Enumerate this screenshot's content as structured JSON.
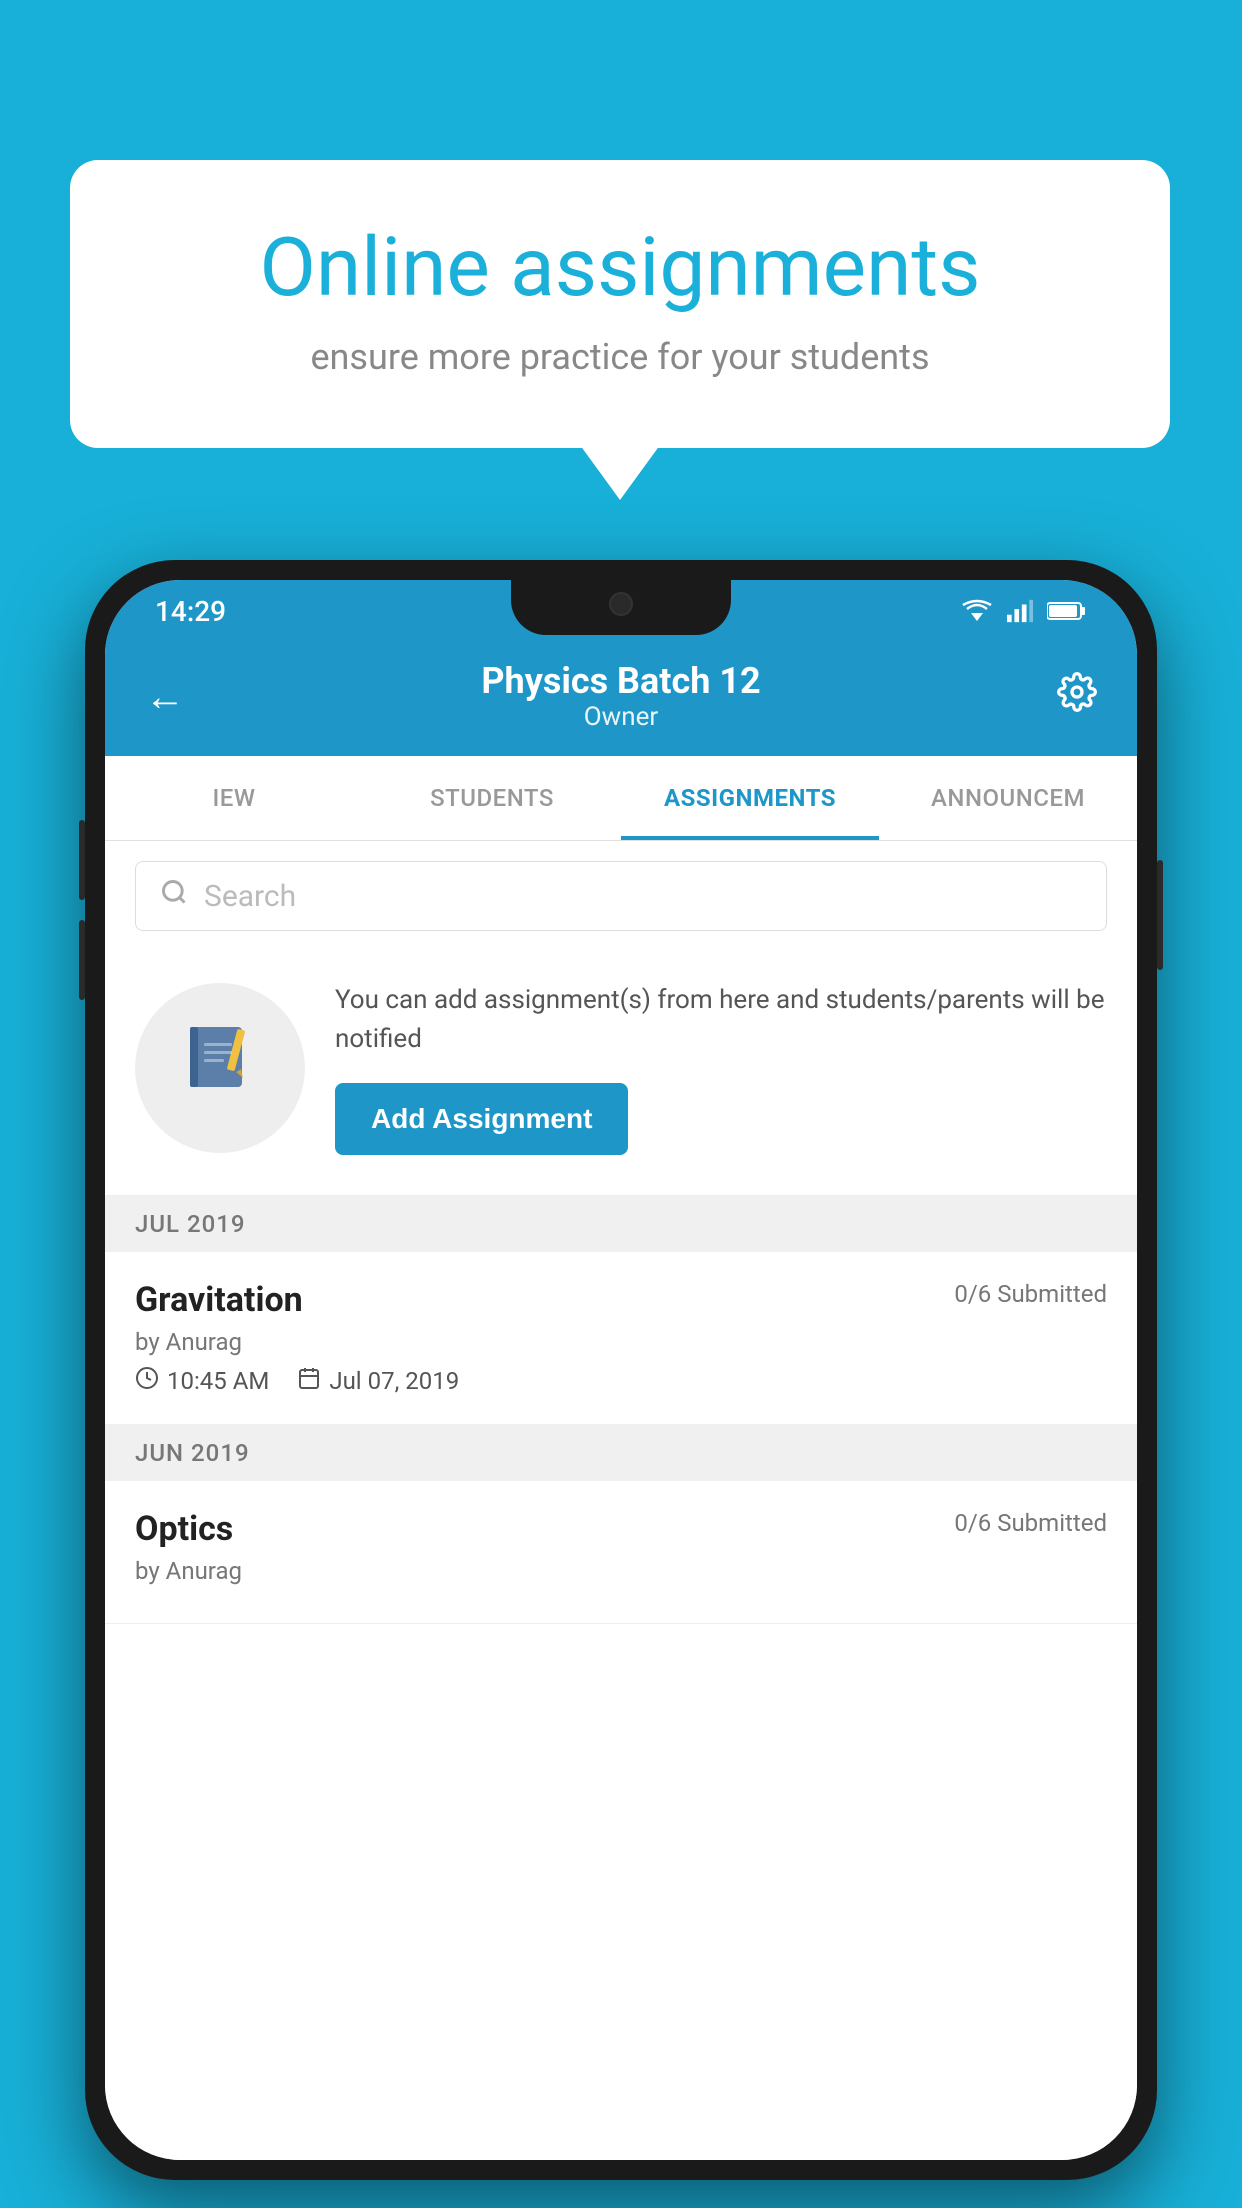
{
  "background": {
    "color": "#18b0d8"
  },
  "speech_bubble": {
    "title": "Online assignments",
    "subtitle": "ensure more practice for your students"
  },
  "phone": {
    "status_bar": {
      "time": "14:29",
      "icons": [
        "wifi",
        "signal",
        "battery"
      ]
    },
    "header": {
      "title": "Physics Batch 12",
      "subtitle": "Owner",
      "back_label": "←",
      "gear_label": "⚙"
    },
    "tabs": [
      {
        "label": "IEW",
        "active": false
      },
      {
        "label": "STUDENTS",
        "active": false
      },
      {
        "label": "ASSIGNMENTS",
        "active": true
      },
      {
        "label": "ANNOUNCEM",
        "active": false
      }
    ],
    "search": {
      "placeholder": "Search"
    },
    "promo_card": {
      "text": "You can add assignment(s) from here and students/parents will be notified",
      "button_label": "Add Assignment"
    },
    "sections": [
      {
        "month": "JUL 2019",
        "assignments": [
          {
            "name": "Gravitation",
            "submitted": "0/6 Submitted",
            "by": "by Anurag",
            "time": "10:45 AM",
            "date": "Jul 07, 2019"
          }
        ]
      },
      {
        "month": "JUN 2019",
        "assignments": [
          {
            "name": "Optics",
            "submitted": "0/6 Submitted",
            "by": "by Anurag",
            "time": "",
            "date": ""
          }
        ]
      }
    ]
  }
}
